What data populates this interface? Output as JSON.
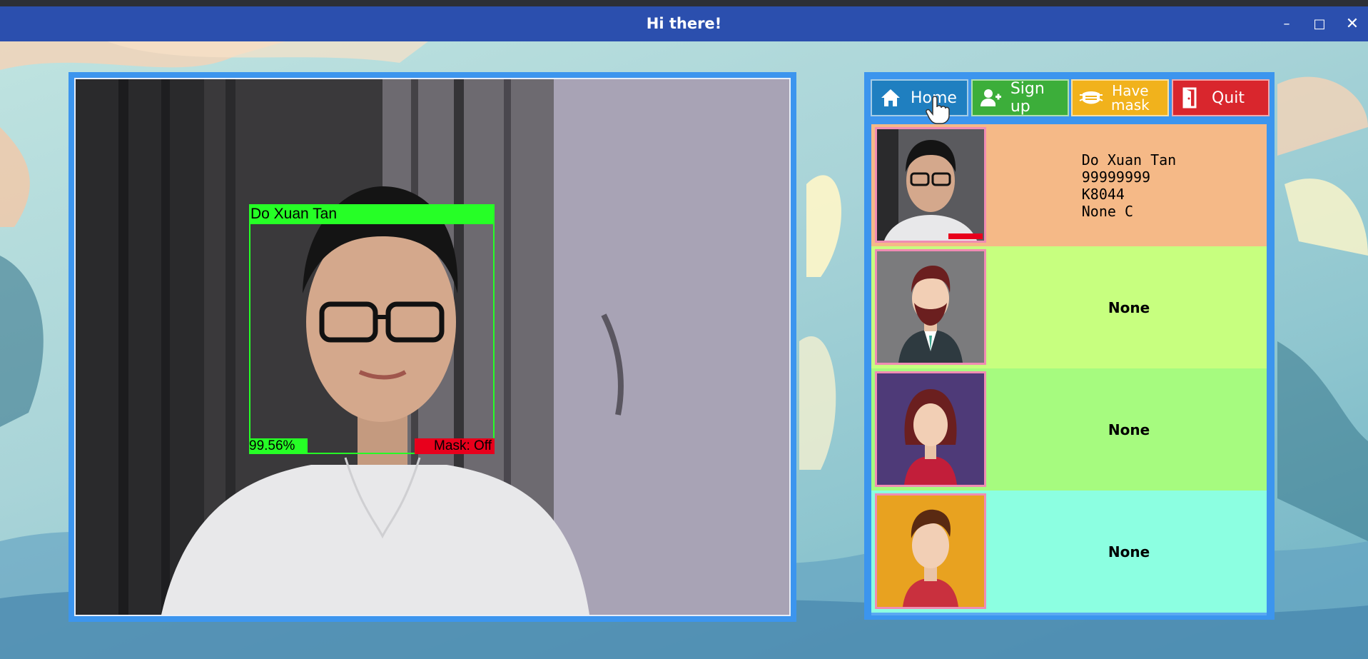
{
  "window": {
    "title": "Hi there!",
    "controls": [
      "–",
      "□",
      "✕"
    ]
  },
  "detection": {
    "name": "Do Xuan Tan",
    "score": "99.56%",
    "mask": "Mask: Off"
  },
  "toolbar": {
    "home_label": "Home",
    "signup_label": "Sign up",
    "mask_label_1": "Have",
    "mask_label_2": "mask",
    "quit_label": "Quit"
  },
  "records": [
    {
      "line1": "Do Xuan Tan",
      "line2": "99999999",
      "line3": "K8044",
      "line4": "None C",
      "avatar": "captured-face",
      "color": "#f5b987"
    },
    {
      "text": "None",
      "avatar": "man-beard-avatar",
      "color": "#c7ff7f"
    },
    {
      "text": "None",
      "avatar": "woman-avatar",
      "color": "#a6fb7f"
    },
    {
      "text": "None",
      "avatar": "young-man-avatar",
      "color": "#8cffe1"
    }
  ],
  "colors": {
    "titlebar": "#2b4fae",
    "frame": "#3c95ee",
    "detection_green": "#26ff26",
    "mask_red": "#e8001c"
  }
}
